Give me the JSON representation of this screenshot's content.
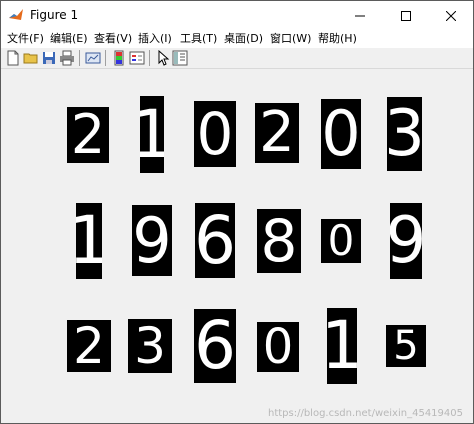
{
  "window": {
    "title": "Figure 1"
  },
  "menu": [
    {
      "label": "文件(F)"
    },
    {
      "label": "编辑(E)"
    },
    {
      "label": "查看(V)"
    },
    {
      "label": "插入(I)"
    },
    {
      "label": "工具(T)"
    },
    {
      "label": "桌面(D)"
    },
    {
      "label": "窗口(W)"
    },
    {
      "label": "帮助(H)"
    }
  ],
  "toolbar": {
    "buttons": [
      "new-figure",
      "open-file",
      "save",
      "print",
      "link-plot",
      "insert-colorbar",
      "insert-legend",
      "edit-plot",
      "property-inspector"
    ]
  },
  "digits": {
    "row1": [
      "2",
      "1",
      "0",
      "2",
      "0",
      "3"
    ],
    "row2": [
      "1",
      "9",
      "6",
      "8",
      "0",
      "9"
    ],
    "row3": [
      "2",
      "3",
      "6",
      "0",
      "1",
      "5"
    ]
  },
  "watermark": "https://blog.csdn.net/weixin_45419405"
}
